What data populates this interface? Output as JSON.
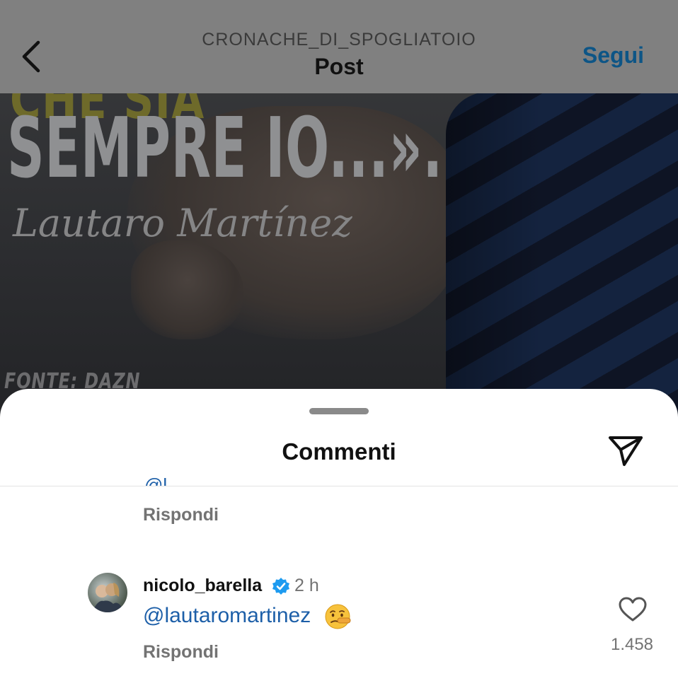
{
  "post": {
    "quote_top": "CHE SIA",
    "quote": "SEMPRE IO...».",
    "author": "Lautaro Martínez",
    "source": "FONTE: DAZN"
  },
  "header": {
    "account": "CRONACHE_DI_SPOGLIATOIO",
    "title": "Post",
    "follow_label": "Segui",
    "back_icon": "chevron-left-icon"
  },
  "comments_sheet": {
    "title": "Commenti",
    "share_icon": "paper-plane-icon",
    "previous_comment": {
      "mention_fragment": "@l",
      "reply_label": "Rispondi"
    },
    "comment": {
      "username": "nicolo_barella",
      "verified": true,
      "time": "2 h",
      "text": "@lautaromartinez",
      "emoji": "lying-face-emoji",
      "reply_label": "Rispondi",
      "likes": "1.458"
    }
  },
  "colors": {
    "link_blue": "#1d5fa8",
    "follow_blue": "#0d5586",
    "verified_blue": "#1d9bf0",
    "muted_text": "#737373"
  }
}
